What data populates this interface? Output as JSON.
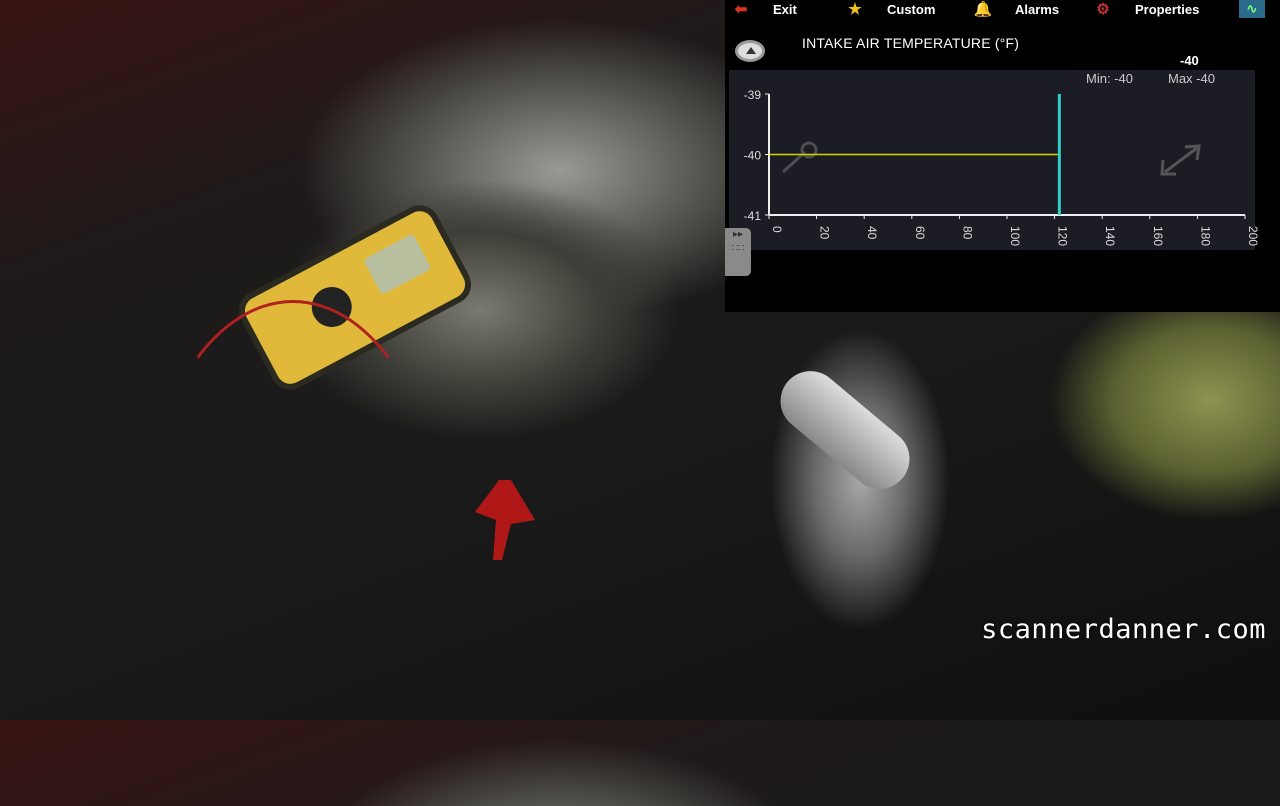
{
  "toolbar": {
    "items": [
      {
        "label": "Exit",
        "icon": "exit-arrow-icon"
      },
      {
        "label": "Custom",
        "icon": "star-icon"
      },
      {
        "label": "Alarms",
        "icon": "bell-icon"
      },
      {
        "label": "Properties",
        "icon": "gear-icon"
      }
    ]
  },
  "graph": {
    "title": "INTAKE AIR TEMPERATURE (°F)",
    "current_value": "-40",
    "min_label": "Min: -40",
    "max_label": "Max -40"
  },
  "chart_data": {
    "type": "line",
    "title": "INTAKE AIR TEMPERATURE (°F)",
    "xlabel": "",
    "ylabel": "",
    "xlim": [
      0,
      200
    ],
    "ylim": [
      -41,
      -39
    ],
    "xticks": [
      "0",
      "20",
      "40",
      "60",
      "80",
      "100",
      "120",
      "140",
      "160",
      "180",
      "200"
    ],
    "yticks": [
      "-39",
      "-40",
      "-41"
    ],
    "series": [
      {
        "name": "Intake Air Temperature",
        "color": "#d4d400",
        "x": [
          0,
          122
        ],
        "y": [
          -40,
          -40
        ]
      }
    ],
    "cursor_x": 122,
    "cursor_color": "#2fd0c8",
    "grid": false
  },
  "watermark": "scannerdanner.com"
}
